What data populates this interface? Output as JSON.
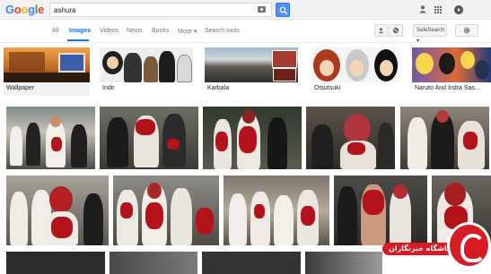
{
  "logo": {
    "letters": [
      "G",
      "o",
      "o",
      "g",
      "l",
      "e"
    ]
  },
  "search": {
    "query": "ashura",
    "placeholder": ""
  },
  "header": {
    "user_icon": "person-icon",
    "apps_icon": "apps-grid-icon",
    "notifications_icon": "play-circle-icon"
  },
  "tabs": [
    {
      "label": "All",
      "active": false
    },
    {
      "label": "Images",
      "active": true
    },
    {
      "label": "Videos",
      "active": false
    },
    {
      "label": "News",
      "active": false
    },
    {
      "label": "Books",
      "active": false
    },
    {
      "label": "More ▾",
      "active": false
    },
    {
      "label": "Search tools",
      "active": false
    }
  ],
  "toolbar": {
    "safesearch_label": "SafeSearch ▾",
    "person_icon": "person-icon",
    "globe_icon": "globe-icon",
    "settings_icon": "gear-icon"
  },
  "related": [
    {
      "label": "Wallpaper"
    },
    {
      "label": "Indir"
    },
    {
      "label": "Karbala"
    },
    {
      "label": "Otsutsuki"
    },
    {
      "label": "Naruto And Indra Sas..."
    }
  ],
  "watermark": {
    "text": "باشگاه خبرنگاران",
    "brand_color": "#d71a23"
  },
  "colors": {
    "accent": "#1a73e8",
    "search_button": "#4d90fe"
  }
}
